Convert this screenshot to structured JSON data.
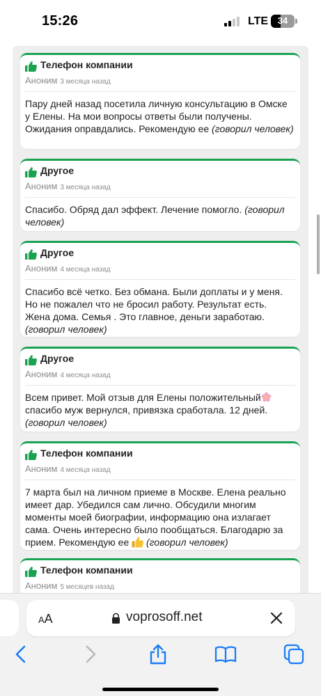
{
  "status_bar": {
    "time": "15:26",
    "network": "LTE",
    "battery": "34"
  },
  "reviews": [
    {
      "category": "Телефон компании",
      "author": "Аноним",
      "when": "3 месяца назад",
      "text": "Пару дней назад посетила личную консультацию в Омске у Елены. На мои вопросы ответы были получены. Ожидания оправдались. Рекомендую ее",
      "note": "(говорил человек)"
    },
    {
      "category": "Другое",
      "author": "Аноним",
      "when": "3 месяца назад",
      "text": "Спасибо. Обряд дал эффект. Лечение помогло.",
      "note": "(говорил человек)"
    },
    {
      "category": "Другое",
      "author": "Аноним",
      "when": "4 месяца назад",
      "text": "Спасибо всё четко. Без обмана. Были доплаты и у меня. Но не пожалел что не бросил работу. Результат есть. Жена дома. Семья . Это главное, деньги заработаю.",
      "note": "(говорил человек)"
    },
    {
      "category": "Другое",
      "author": "Аноним",
      "when": "4 месяца назад",
      "text_a": "Всем привет. Мой отзыв для Елены положительный",
      "text_b": "спасибо муж вернулся, привязка сработала. 12 дней.",
      "note": "(говорил человек)"
    },
    {
      "category": "Телефон компании",
      "author": "Аноним",
      "when": "4 месяца назад",
      "text": "7 марта был на личном приеме в Москве. Елена реально имеет дар. Убедился сам лично. Обсудили многим моменты моей биографии, информацию она излагает сама. Очень интересно было пообщаться. Благодарю за прием. Рекомендую ее",
      "note": "(говорил человек)"
    },
    {
      "category": "Телефон компании",
      "author": "Аноним",
      "when": "5 месяцев назад"
    }
  ],
  "browser": {
    "aa_small": "A",
    "aa_large": "A",
    "domain": "voprosoff.net"
  },
  "icons": {
    "category": "thumbs-up-icon",
    "lock": "lock-icon",
    "clear": "close-icon",
    "back": "chevron-left-icon",
    "forward": "chevron-right-icon",
    "share": "share-icon",
    "bookmarks": "book-icon",
    "tabs": "tabs-icon"
  },
  "colors": {
    "accent_green": "#1aa251",
    "safari_blue": "#1a7cf5"
  }
}
